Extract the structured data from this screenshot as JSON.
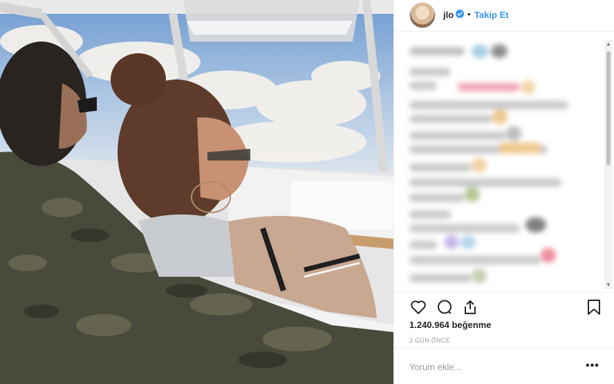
{
  "post": {
    "username": "jlo",
    "follow_label": "Takip Et",
    "separator": "•",
    "likes": "1.240.964 beğenme",
    "time": "2 GÜN ÖNCE",
    "comment_placeholder": "Yorum ekle...",
    "more_label": "•••"
  },
  "scrollbar": {
    "up_glyph": "▲",
    "down_glyph": "▼"
  },
  "colors": {
    "accent": "#3897f0",
    "text": "#262626",
    "muted": "#999999",
    "border": "#efefef"
  },
  "icons": {
    "verified": "verified-badge-icon",
    "like": "heart-icon",
    "comment": "comment-icon",
    "share": "share-icon",
    "save": "bookmark-icon"
  }
}
